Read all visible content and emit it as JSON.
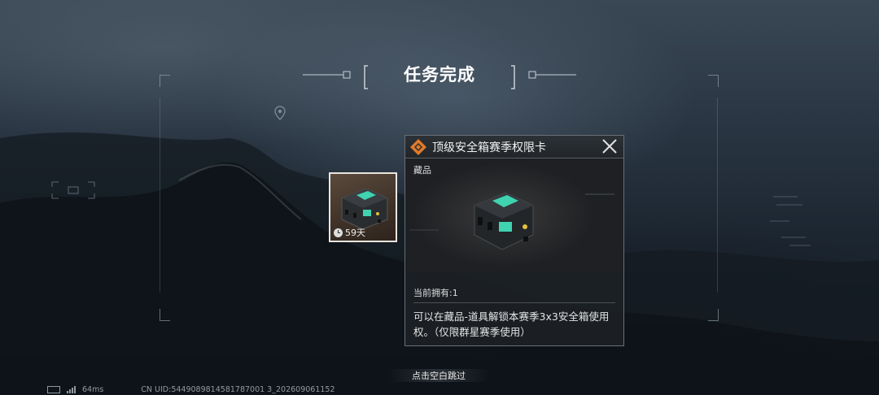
{
  "header": {
    "title": "任务完成"
  },
  "reward_item": {
    "duration": "59天"
  },
  "detail_panel": {
    "title": "顶级安全箱赛季权限卡",
    "category": "藏品",
    "owned": "当前拥有:1",
    "description": "可以在藏品-道具解锁本赛季3x3安全箱使用权。（仅限群星赛季使用）"
  },
  "skip_hint": "点击空白跳过",
  "status_bar": {
    "ping": "64ms",
    "uid": "CN UID:5449089814581787001 3_202609061152"
  },
  "colors": {
    "rarity_orange": "#e07a2a",
    "case_green": "#3fd3b0",
    "accent_white": "#e9e6df"
  }
}
